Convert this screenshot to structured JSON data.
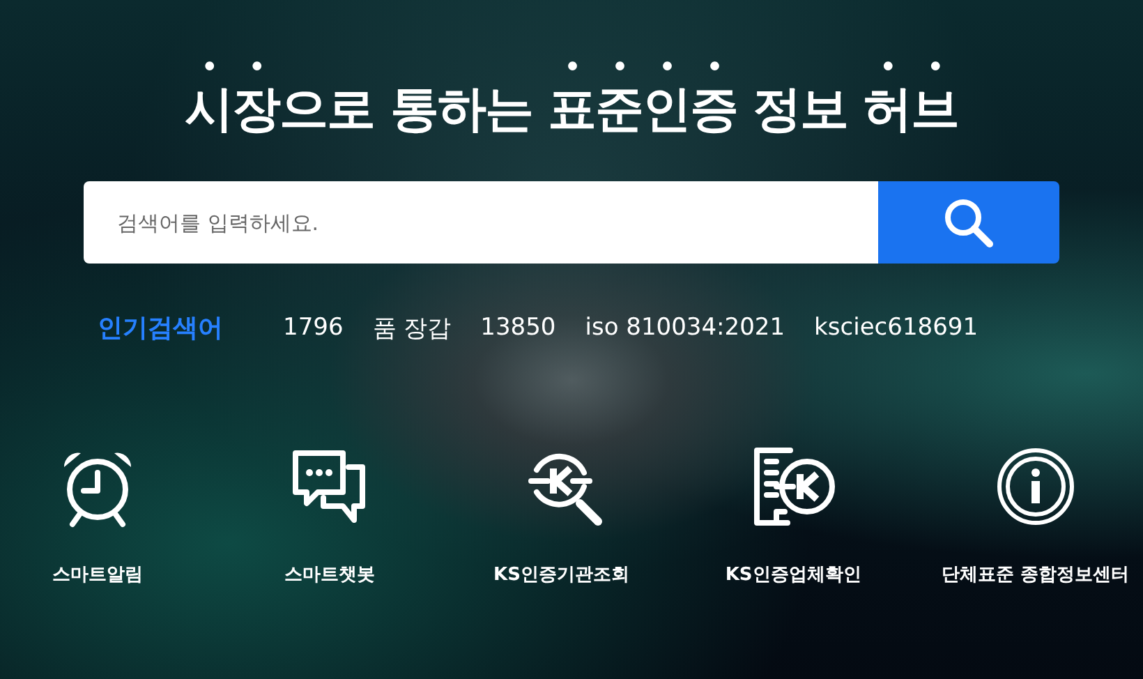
{
  "hero": {
    "title": [
      {
        "text": "시장",
        "emphasis": true
      },
      {
        "text": "으로 통하는 ",
        "emphasis": false
      },
      {
        "text": "표준인증",
        "emphasis": true
      },
      {
        "text": " 정보 ",
        "emphasis": false
      },
      {
        "text": "허브",
        "emphasis": true
      }
    ]
  },
  "search": {
    "placeholder": "검색어를 입력하세요."
  },
  "popular": {
    "label": "인기검색어",
    "terms": [
      "1796",
      "품 장갑",
      "13850",
      "iso 810034:2021",
      "ksciec618691"
    ]
  },
  "shortcuts": [
    {
      "kind": "alarm",
      "label": "스마트알림"
    },
    {
      "kind": "chat",
      "label": "스마트챗봇"
    },
    {
      "kind": "ks-search",
      "label": "KS인증기관조회"
    },
    {
      "kind": "ks-building",
      "label": "KS인증업체확인"
    },
    {
      "kind": "info",
      "label": "단체표준 종합정보센터"
    }
  ]
}
